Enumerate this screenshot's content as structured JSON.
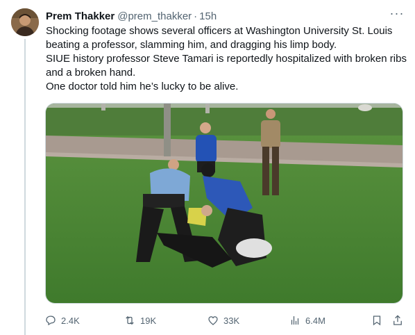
{
  "tweet": {
    "author_name": "Prem Thakker",
    "author_handle": "@prem_thakker",
    "separator": "·",
    "time": "15h",
    "more_label": "···",
    "lines": [
      "Shocking footage shows several officers at Washington University St. Louis beating a professor, slamming him, and dragging his limp body.",
      "SIUE history professor Steve Tamari is reportedly hospitalized with broken ribs and a broken hand.",
      "One doctor told him he’s lucky to be alive."
    ]
  },
  "actions": {
    "replies": "2.4K",
    "reposts": "19K",
    "likes": "33K",
    "views": "6.4M"
  },
  "icons": {
    "reply": "reply-icon",
    "repost": "repost-icon",
    "like": "heart-icon",
    "views": "views-chart-icon",
    "bookmark": "bookmark-icon",
    "share": "share-icon",
    "more": "more-icon"
  },
  "colors": {
    "text_primary": "#0f1419",
    "text_secondary": "#536471",
    "border": "#cfd9de",
    "grass": "#4e8a35"
  }
}
